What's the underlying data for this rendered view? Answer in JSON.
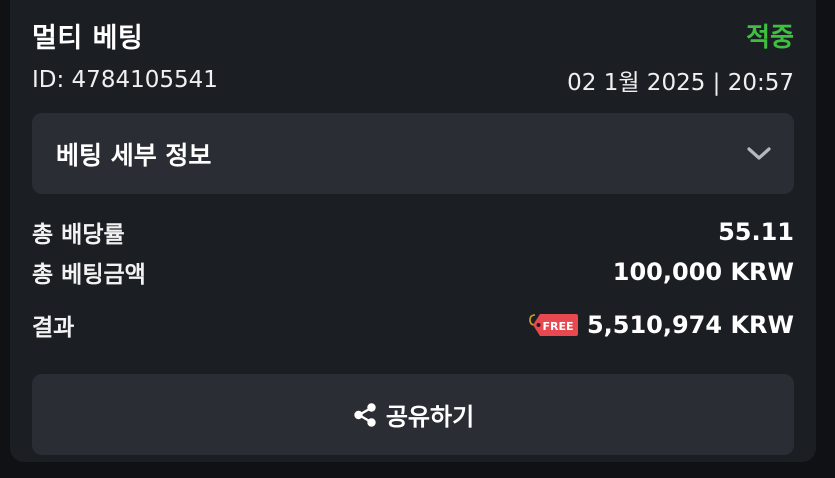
{
  "bet": {
    "title": "멀티 베팅",
    "status": "적중",
    "status_color": "#3fbf3f",
    "id_text": "ID: 4784105541",
    "datetime": "02 1월 2025 | 20:57"
  },
  "details": {
    "label": "베팅 세부 정보",
    "icon": "chevron-down-icon"
  },
  "summary": {
    "total_odds_label": "총 배당률",
    "total_odds_value": "55.11",
    "total_stake_label": "총 베팅금액",
    "total_stake_value": "100,000 KRW",
    "result_label": "결과",
    "result_badge": "FREE",
    "result_badge_color": "#e8484f",
    "result_value": "5,510,974 KRW"
  },
  "share": {
    "label": "공유하기",
    "icon": "share-icon"
  }
}
